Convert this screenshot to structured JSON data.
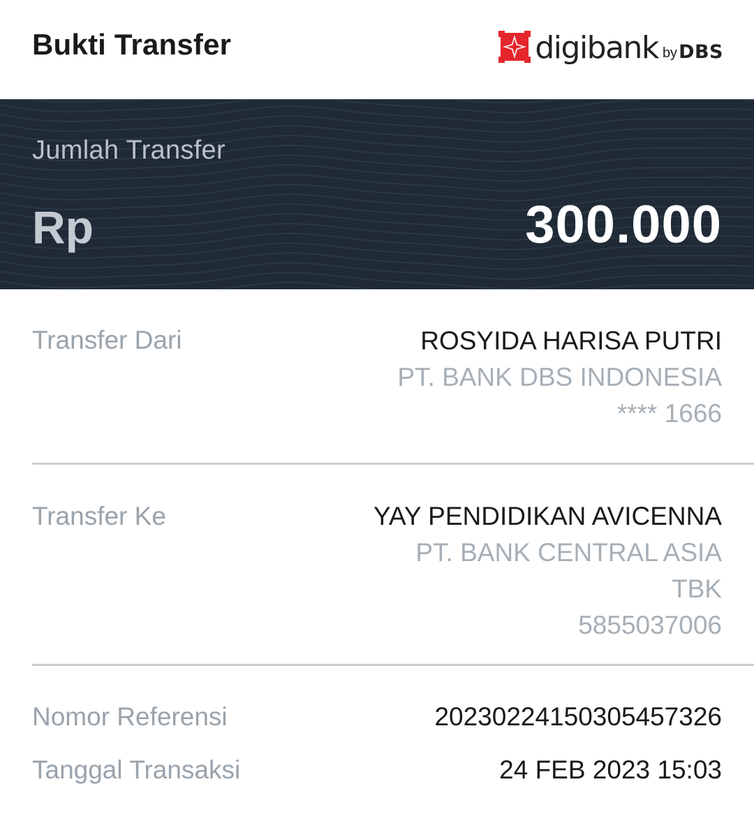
{
  "header": {
    "title": "Bukti Transfer",
    "brand": {
      "name": "digibank",
      "by": "by",
      "suffix": "DBS",
      "logo_icon": "dbs-star-logo",
      "logo_color": "#e4262c"
    }
  },
  "amount": {
    "label": "Jumlah Transfer",
    "currency": "Rp",
    "value": "300.000",
    "panel_color": "#1f2a36"
  },
  "transfer_from": {
    "label": "Transfer Dari",
    "name": "ROSYIDA HARISA PUTRI",
    "bank": "PT. BANK DBS INDONESIA",
    "account": "**** 1666"
  },
  "transfer_to": {
    "label": "Transfer Ke",
    "name": "YAY PENDIDIKAN AVICENNA",
    "bank_line1": "PT. BANK CENTRAL ASIA",
    "bank_line2": "TBK",
    "account": "5855037006"
  },
  "details": {
    "reference_label": "Nomor Referensi",
    "reference_value": "20230224150305457326",
    "date_label": "Tanggal Transaksi",
    "date_value": "24 FEB 2023 15:03"
  }
}
